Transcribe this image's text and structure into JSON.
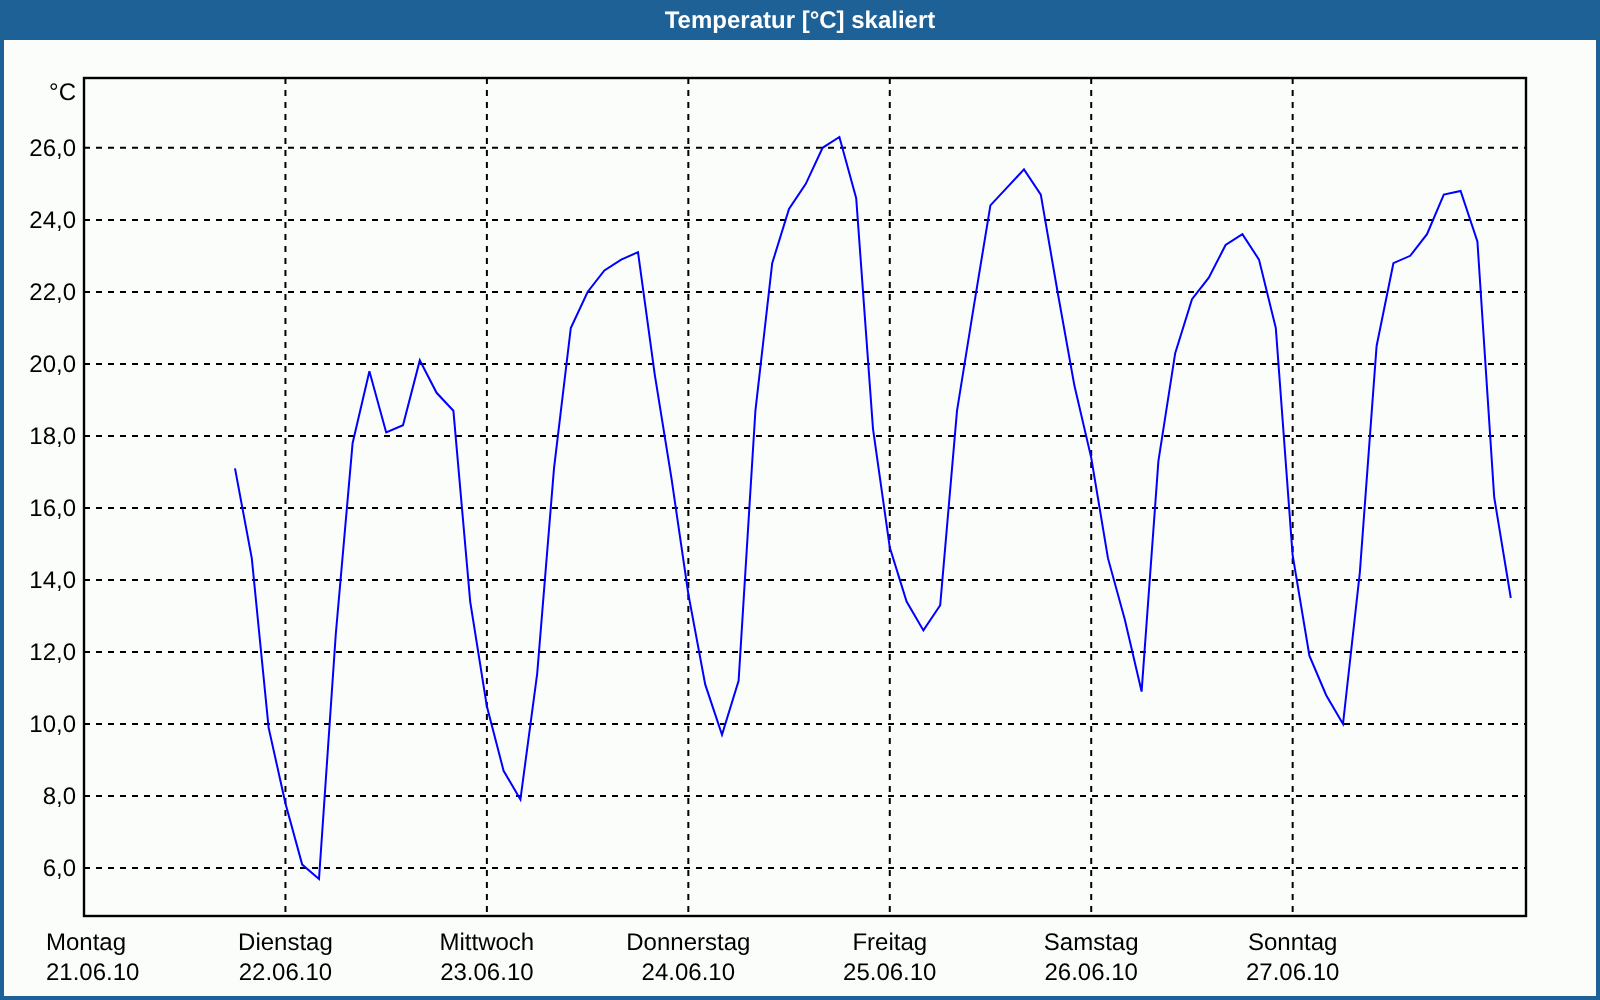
{
  "window": {
    "title": "Temperatur [°C] skaliert"
  },
  "chart": {
    "chart_data": {
      "type": "line",
      "ylabel": "°C",
      "grid": true,
      "ylim": [
        4.67,
        27.94
      ],
      "yticks": [
        {
          "value": 6,
          "label": "6,0"
        },
        {
          "value": 8,
          "label": "8,0"
        },
        {
          "value": 10,
          "label": "10,0"
        },
        {
          "value": 12,
          "label": "12,0"
        },
        {
          "value": 14,
          "label": "14,0"
        },
        {
          "value": 16,
          "label": "16,0"
        },
        {
          "value": 18,
          "label": "18,0"
        },
        {
          "value": 20,
          "label": "20,0"
        },
        {
          "value": 22,
          "label": "22,0"
        },
        {
          "value": 24,
          "label": "24,0"
        },
        {
          "value": 26,
          "label": "26,0"
        }
      ],
      "categories": [
        "Montag",
        null,
        null,
        null,
        null,
        null,
        null,
        null,
        null,
        null,
        null,
        null,
        "Dienstag",
        null,
        null,
        null,
        null,
        null,
        null,
        null,
        null,
        null,
        null,
        null,
        "Mittwoch",
        null,
        null,
        null,
        null,
        null,
        null,
        null,
        null,
        null,
        null,
        null,
        "Donnerstag",
        null,
        null,
        null,
        null,
        null,
        null,
        null,
        null,
        null,
        null,
        null,
        "Freitag",
        null,
        null,
        null,
        null,
        null,
        null,
        null,
        null,
        null,
        null,
        null,
        "Samstag",
        null,
        null,
        null,
        null,
        null,
        null,
        null,
        null,
        null,
        null,
        null,
        "Sonntag",
        null,
        null,
        null,
        null,
        null,
        null,
        null,
        null,
        null,
        null,
        null,
        null,
        null
      ],
      "annotations": [
        "21.06.10",
        "22.06.10",
        "23.06.10",
        "24.06.10",
        "25.06.10",
        "26.06.10",
        "27.06.10"
      ],
      "series": [
        {
          "color": "#0000ff",
          "values": [
            null,
            null,
            null,
            null,
            null,
            null,
            null,
            null,
            null,
            17.1,
            14.6,
            9.9,
            7.8,
            6.1,
            5.7,
            12.5,
            17.8,
            19.8,
            18.1,
            18.3,
            20.1,
            19.2,
            18.7,
            13.4,
            10.5,
            8.7,
            7.9,
            11.4,
            17.1,
            21.0,
            22.0,
            22.6,
            22.9,
            23.1,
            19.7,
            16.8,
            13.6,
            11.1,
            9.7,
            11.2,
            18.7,
            22.8,
            24.3,
            25.0,
            26.0,
            26.3,
            24.6,
            18.2,
            14.9,
            13.4,
            12.6,
            13.3,
            18.7,
            21.6,
            24.4,
            24.9,
            25.4,
            24.7,
            22.0,
            19.4,
            17.4,
            14.6,
            12.9,
            10.9,
            17.3,
            20.3,
            21.8,
            22.4,
            23.3,
            23.6,
            22.9,
            21.0,
            14.7,
            11.9,
            10.8,
            10.0,
            14.2,
            20.5,
            22.8,
            23.0,
            23.6,
            24.7,
            24.8,
            23.4,
            16.3,
            13.5
          ]
        }
      ]
    }
  }
}
